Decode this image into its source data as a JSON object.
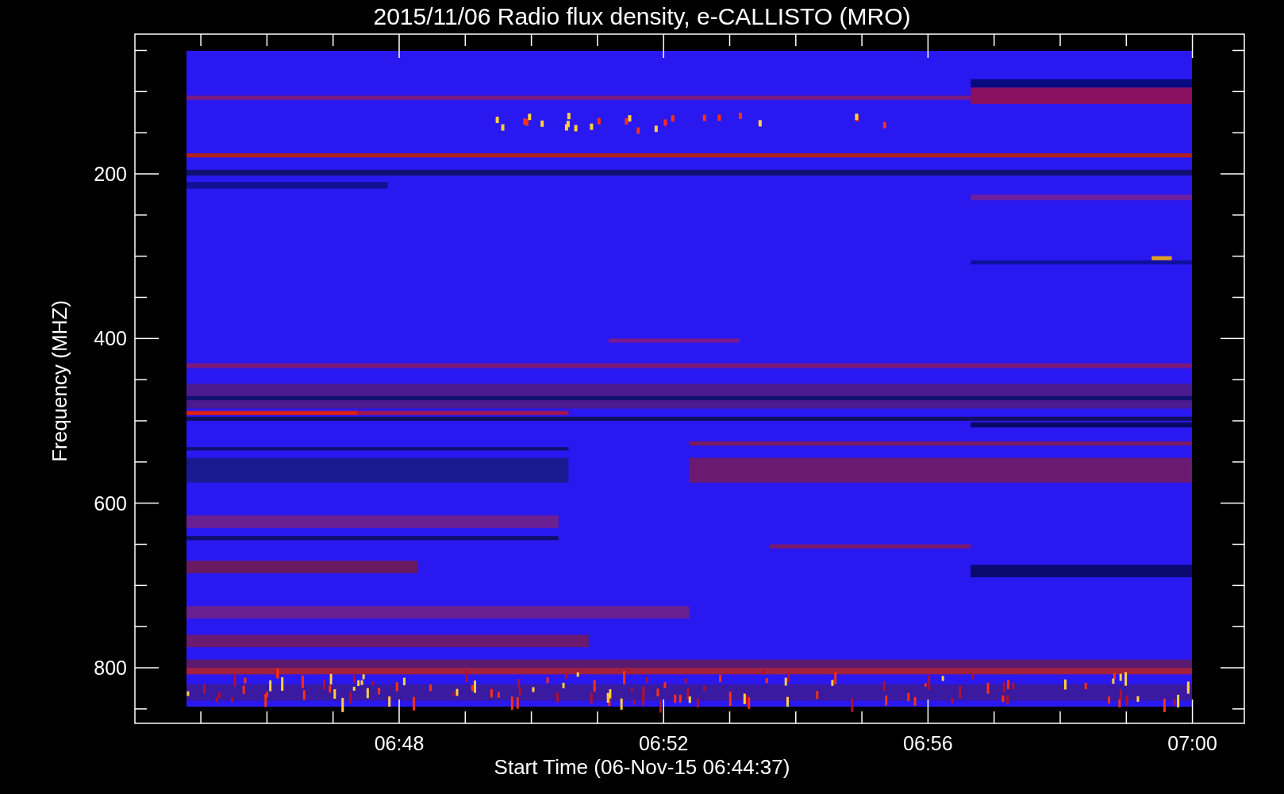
{
  "title": "2015/11/06  Radio flux density, e-CALLISTO (MRO)",
  "y_axis": {
    "label": "Frequency (MHZ)",
    "ticks": [
      "200",
      "400",
      "600",
      "800"
    ]
  },
  "x_axis": {
    "label": "Start Time (06-Nov-15 06:44:37)",
    "ticks": [
      "06:48",
      "06:52",
      "06:56",
      "07:00"
    ]
  }
}
